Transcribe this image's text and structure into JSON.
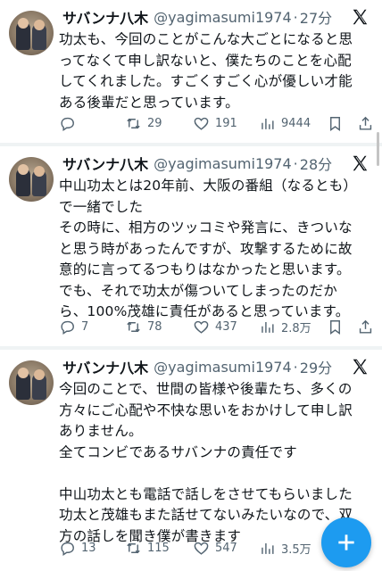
{
  "tweets": [
    {
      "name": "サバンナ八木",
      "handle": "@yagimasumi1974",
      "time": "27分",
      "text": "功太も、今回のことがこんな大ごとになると思\nってなくて申し訳ないと、僕たちのことを心配\nしてくれました。すごくすごく心が優しい才能\nある後輩だと思っています。",
      "replies": "",
      "retweets": "29",
      "likes": "191",
      "views": "9444"
    },
    {
      "name": "サバンナ八木",
      "handle": "@yagimasumi1974",
      "time": "28分",
      "text": "中山功太とは20年前、大阪の番組（なるとも）\nで一緒でした\nその時に、相方のツッコミや発言に、きついな\nと思う時があったんですが、攻撃するために故\n意的に言ってるつもりはなかったと思います。\nでも、それで功太が傷ついてしまったのだか\nら、100%茂雄に責任があると思っています。",
      "replies": "7",
      "retweets": "78",
      "likes": "437",
      "views": "2.8万"
    },
    {
      "name": "サバンナ八木",
      "handle": "@yagimasumi1974",
      "time": "29分",
      "text": "今回のことで、世間の皆様や後輩たち、多くの\n方々にご心配や不快な思いをおかけして申し訳\nありません。\n全てコンビであるサバンナの責任です\n\n中山功太とも電話で話しをさせてもらいました\n功太と茂雄もまた話せてないみたいなので、双\n方の話しを聞き僕が書きます",
      "replies": "13",
      "retweets": "115",
      "likes": "547",
      "views": "3.5万"
    }
  ],
  "icons": {
    "reply": "reply-icon",
    "retweet": "retweet-icon",
    "like": "heart-icon",
    "views": "views-icon",
    "bookmark": "bookmark-icon",
    "share": "share-icon",
    "logo": "x-logo-icon",
    "compose": "compose-plus-icon"
  },
  "colors": {
    "accent": "#1d9bf0",
    "text": "#0f1419",
    "secondary": "#536471",
    "separator": "#eff3f4"
  }
}
